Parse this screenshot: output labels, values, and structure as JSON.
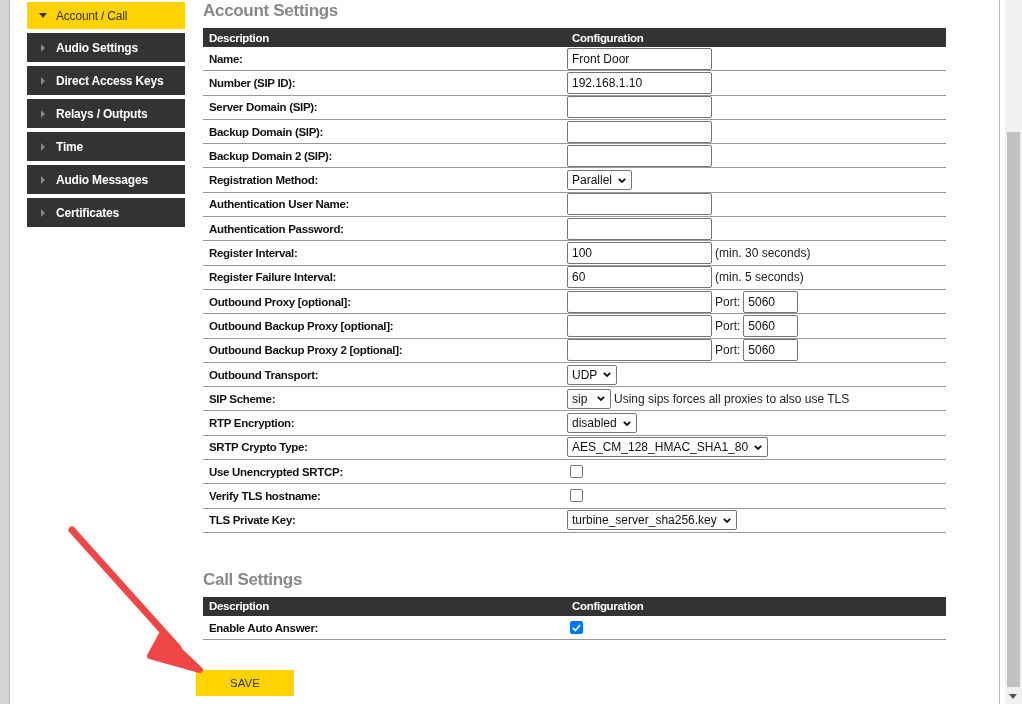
{
  "sidebar": {
    "items": [
      {
        "label": "Account / Call",
        "selected": true
      },
      {
        "label": "Audio Settings",
        "selected": false
      },
      {
        "label": "Direct Access Keys",
        "selected": false
      },
      {
        "label": "Relays / Outputs",
        "selected": false
      },
      {
        "label": "Time",
        "selected": false
      },
      {
        "label": "Audio Messages",
        "selected": false
      },
      {
        "label": "Certificates",
        "selected": false
      }
    ]
  },
  "sections": [
    {
      "title": "Account Settings",
      "columns": [
        "Description",
        "Configuration"
      ],
      "rows": [
        {
          "label": "Name:",
          "kind": "text",
          "value": "Front Door"
        },
        {
          "label": "Number (SIP ID):",
          "kind": "text",
          "value": "192.168.1.10"
        },
        {
          "label": "Server Domain (SIP):",
          "kind": "text"
        },
        {
          "label": "Backup Domain (SIP):",
          "kind": "text"
        },
        {
          "label": "Backup Domain 2 (SIP):",
          "kind": "text"
        },
        {
          "label": "Registration Method:",
          "kind": "select",
          "value": "Parallel"
        },
        {
          "label": "Authentication User Name:",
          "kind": "text"
        },
        {
          "label": "Authentication Password:",
          "kind": "text"
        },
        {
          "label": "Register Interval:",
          "kind": "text",
          "value": "100",
          "note": "(min. 30 seconds)"
        },
        {
          "label": "Register Failure Interval:",
          "kind": "text",
          "value": "60",
          "note": "(min. 5 seconds)"
        },
        {
          "label": "Outbound Proxy [optional]:",
          "kind": "text",
          "port_label": "Port:",
          "port": "5060"
        },
        {
          "label": "Outbound Backup Proxy [optional]:",
          "kind": "text",
          "port_label": "Port:",
          "port": "5060"
        },
        {
          "label": "Outbound Backup Proxy 2 [optional]:",
          "kind": "text",
          "port_label": "Port:",
          "port": "5060"
        },
        {
          "label": "Outbound Transport:",
          "kind": "select",
          "value": "UDP"
        },
        {
          "label": "SIP Scheme:",
          "kind": "select",
          "value": "sip",
          "note": "Using sips forces all proxies to also use TLS"
        },
        {
          "label": "RTP Encryption:",
          "kind": "select",
          "value": "disabled"
        },
        {
          "label": "SRTP Crypto Type:",
          "kind": "select",
          "value": "AES_CM_128_HMAC_SHA1_80"
        },
        {
          "label": "Use Unencrypted SRTCP:",
          "kind": "checkbox",
          "checked": false
        },
        {
          "label": "Verify TLS hostname:",
          "kind": "checkbox",
          "checked": false
        },
        {
          "label": "TLS Private Key:",
          "kind": "select",
          "value": "turbine_server_sha256.key"
        }
      ]
    },
    {
      "title": "Call Settings",
      "columns": [
        "Description",
        "Configuration"
      ],
      "rows": [
        {
          "label": "Enable Auto Answer:",
          "kind": "checkbox",
          "checked": true
        }
      ]
    }
  ],
  "save_button": "SAVE"
}
